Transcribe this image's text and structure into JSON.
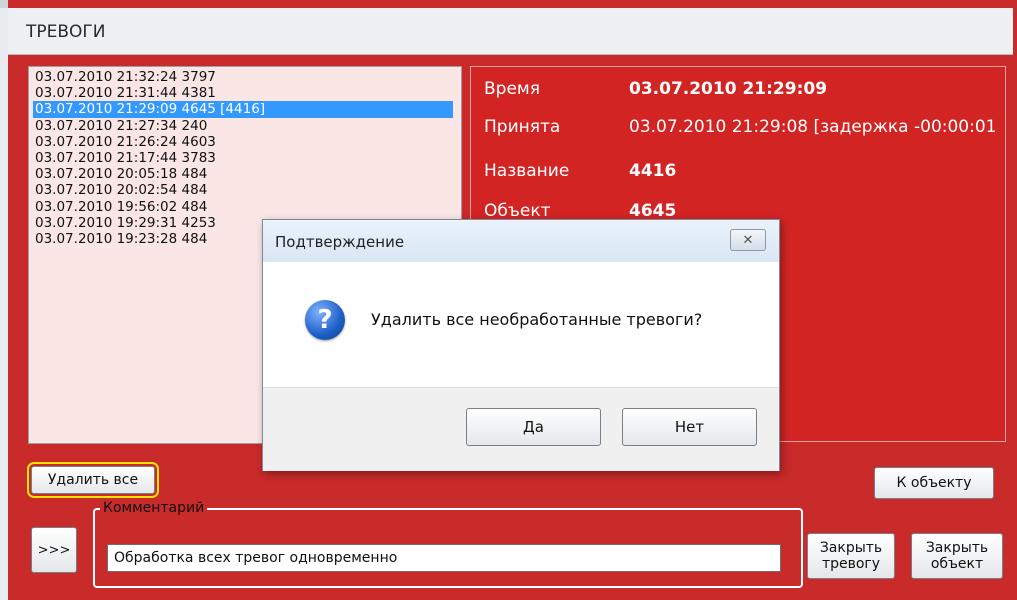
{
  "window": {
    "title": "ТРЕВОГИ"
  },
  "alarms": [
    "03.07.2010 21:32:24  3797",
    "03.07.2010 21:31:44  4381",
    "03.07.2010 21:29:09  4645 [4416]",
    "03.07.2010 21:27:34  240",
    "03.07.2010 21:26:24  4603",
    "03.07.2010 21:17:44  3783",
    "03.07.2010 20:05:18  484",
    "03.07.2010 20:02:54  484",
    "03.07.2010 19:56:02  484",
    "03.07.2010 19:29:31  4253",
    "03.07.2010 19:23:28  484"
  ],
  "details": {
    "time_label": "Время",
    "time_value": "03.07.2010 21:29:09",
    "received_label": "Принята",
    "received_value": "03.07.2010 21:29:08 [задержка -00:00:01",
    "name_label": "Название",
    "name_value": "4416",
    "object_label": "Объект",
    "object_value": "4645"
  },
  "buttons": {
    "delete_all": "Удалить все",
    "to_object": "К объекту",
    "expand": ">>>",
    "close_alarm": "Закрыть тревогу",
    "close_object": "Закрыть объект"
  },
  "comment": {
    "legend": "Комментарий",
    "value": "Обработка всех тревог одновременно"
  },
  "dialog": {
    "title": "Подтверждение",
    "close_symbol": "✕",
    "icon_symbol": "?",
    "message": "Удалить все необработанные тревоги?",
    "yes": "Да",
    "no": "Нет"
  },
  "colors": {
    "frame": "#c92a2a",
    "detail_panel": "#d32424",
    "list_bg": "#fbe6e6",
    "selection": "#3399ff",
    "highlight": "#f6e500"
  }
}
